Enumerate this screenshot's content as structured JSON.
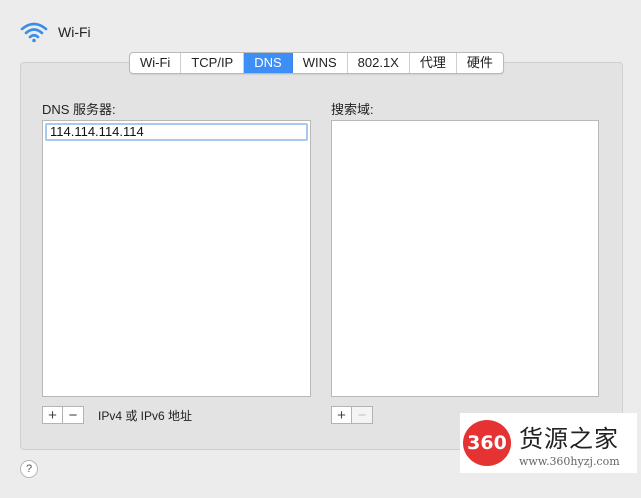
{
  "header": {
    "title": "Wi-Fi",
    "icon": "wifi-icon"
  },
  "tabs": [
    {
      "label": "Wi-Fi"
    },
    {
      "label": "TCP/IP"
    },
    {
      "label": "DNS",
      "active": true
    },
    {
      "label": "WINS"
    },
    {
      "label": "802.1X"
    },
    {
      "label": "代理"
    },
    {
      "label": "硬件"
    }
  ],
  "dns": {
    "label": "DNS 服务器:",
    "servers": [
      "114.114.114.114"
    ],
    "add": "+",
    "remove": "−",
    "hint": "IPv4 或 IPv6 地址"
  },
  "search_domains": {
    "label": "搜索域:",
    "add": "+",
    "remove": "−"
  },
  "help": "?",
  "watermark": {
    "logo": "360",
    "title": "货源之家",
    "url": "www.360hyzj.com"
  },
  "colors": {
    "accent": "#3d8ef7",
    "watermark_red": "#e53232"
  }
}
